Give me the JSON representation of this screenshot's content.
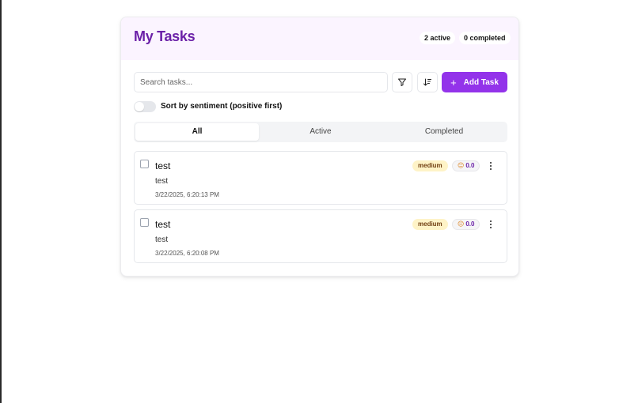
{
  "header": {
    "title": "My Tasks",
    "active_count": "2 active",
    "completed_count": "0 completed"
  },
  "toolbar": {
    "search_placeholder": "Search tasks...",
    "filter_icon": "filter-icon",
    "sort_icon": "sort-icon",
    "add_label": "Add Task",
    "add_icon": "plus-icon"
  },
  "sentiment_toggle": {
    "label": "Sort by sentiment (positive first)",
    "enabled": false
  },
  "tabs": [
    {
      "label": "All",
      "selected": true
    },
    {
      "label": "Active",
      "selected": false
    },
    {
      "label": "Completed",
      "selected": false
    }
  ],
  "tasks": [
    {
      "title": "test",
      "description": "test",
      "date": "3/22/2025, 6:20:13 PM",
      "priority": "medium",
      "sentiment_icon": "neutral-face-icon",
      "sentiment_score": "0.0",
      "completed": false
    },
    {
      "title": "test",
      "description": "test",
      "date": "3/22/2025, 6:20:08 PM",
      "priority": "medium",
      "sentiment_icon": "neutral-face-icon",
      "sentiment_score": "0.0",
      "completed": false
    }
  ],
  "colors": {
    "accent": "#9333ea",
    "title": "#6b21a8",
    "header_bg": "#fbf4ff",
    "priority_bg": "#fef3c7"
  }
}
